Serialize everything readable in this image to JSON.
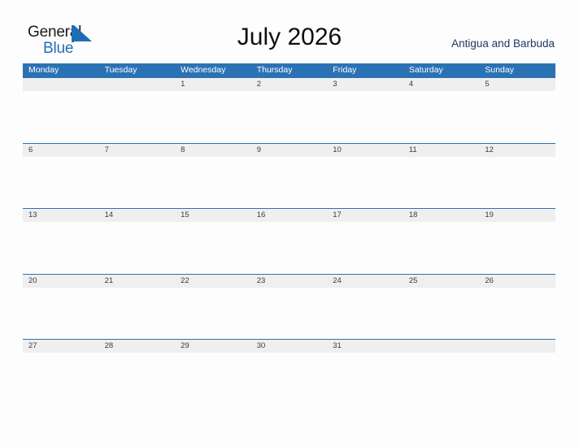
{
  "brand": {
    "name_part1": "General",
    "name_part2": "Blue",
    "triangle_icon": "blue-triangle-icon",
    "color_primary": "#1f6eb5",
    "color_dark": "#1a1a1a"
  },
  "header": {
    "title": "July 2026",
    "country": "Antigua and Barbuda"
  },
  "calendar": {
    "month": "July",
    "year": "2026",
    "header_bg": "#2b72b4",
    "row_band_bg": "#efefef",
    "row_rule_color": "#2b72b4",
    "day_names": [
      "Monday",
      "Tuesday",
      "Wednesday",
      "Thursday",
      "Friday",
      "Saturday",
      "Sunday"
    ],
    "weeks": [
      [
        "",
        "",
        "1",
        "2",
        "3",
        "4",
        "5"
      ],
      [
        "6",
        "7",
        "8",
        "9",
        "10",
        "11",
        "12"
      ],
      [
        "13",
        "14",
        "15",
        "16",
        "17",
        "18",
        "19"
      ],
      [
        "20",
        "21",
        "22",
        "23",
        "24",
        "25",
        "26"
      ],
      [
        "27",
        "28",
        "29",
        "30",
        "31",
        "",
        ""
      ]
    ]
  }
}
